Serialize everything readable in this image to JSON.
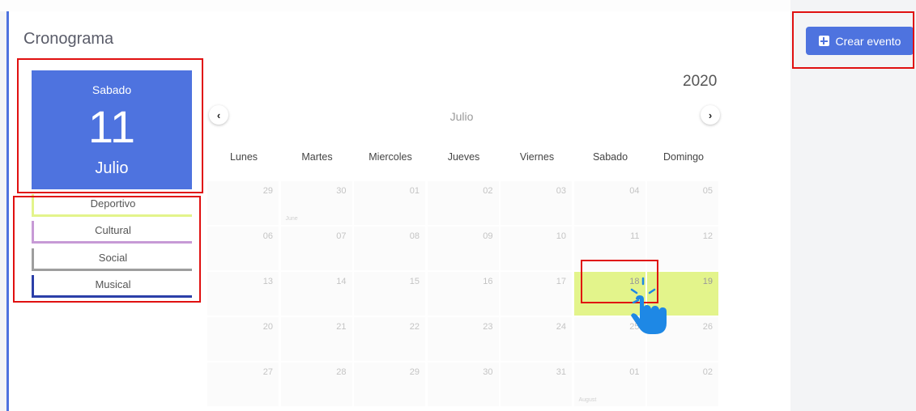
{
  "page": {
    "title": "Cronograma"
  },
  "toolbar": {
    "create_label": "Crear evento"
  },
  "selected_date": {
    "weekday": "Sabado",
    "day": "11",
    "month": "Julio"
  },
  "categories": [
    {
      "label": "Deportivo",
      "color": "#e3f48b"
    },
    {
      "label": "Cultural",
      "color": "#c79ad6"
    },
    {
      "label": "Social",
      "color": "#9e9e9e"
    },
    {
      "label": "Musical",
      "color": "#2c3fa8"
    }
  ],
  "calendar": {
    "year": "2020",
    "month": "Julio",
    "weekdays": [
      "Lunes",
      "Martes",
      "Miercoles",
      "Jueves",
      "Viernes",
      "Sabado",
      "Domingo"
    ],
    "weeks": [
      [
        "29",
        "30",
        "01",
        "02",
        "03",
        "04",
        "05"
      ],
      [
        "06",
        "07",
        "08",
        "09",
        "10",
        "11",
        "12"
      ],
      [
        "13",
        "14",
        "15",
        "16",
        "17",
        "18",
        "19"
      ],
      [
        "20",
        "21",
        "22",
        "23",
        "24",
        "25",
        "26"
      ],
      [
        "27",
        "28",
        "29",
        "30",
        "31",
        "01",
        "02"
      ]
    ],
    "month_markers": [
      {
        "week": 0,
        "col": 1,
        "label": "June"
      },
      {
        "week": 4,
        "col": 5,
        "label": "August"
      }
    ],
    "highlighted_days": [
      "18",
      "19"
    ],
    "highlight_color": "#e3f48b"
  },
  "colors": {
    "accent": "#4e73df",
    "annotation": "#e01010"
  }
}
